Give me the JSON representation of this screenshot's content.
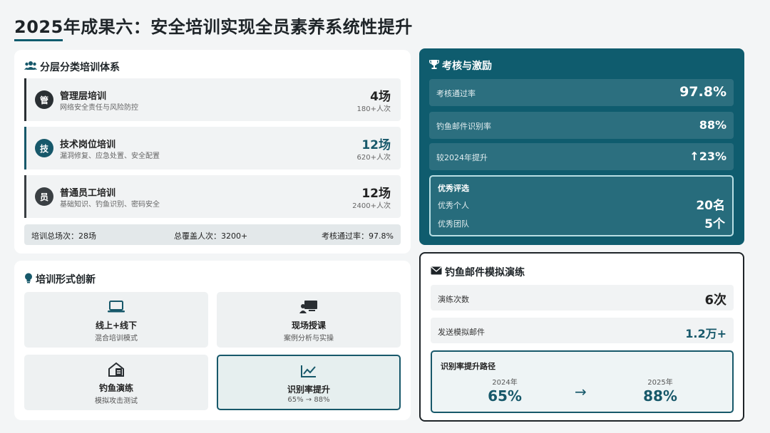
{
  "page": {
    "title": "2025年成果六：安全培训实现全员素养系统性提升"
  },
  "tiers_card": {
    "heading": "分层分类培训体系",
    "tiers": [
      {
        "badge": "管",
        "name": "管理层培训",
        "desc": "网络安全责任与风险防控",
        "value": "4场",
        "sub": "180+人次",
        "badge_color": "#2a2f33",
        "bar_color": "#2a2f33",
        "value_color": "#222222"
      },
      {
        "badge": "技",
        "name": "技术岗位培训",
        "desc": "漏洞修复、应急处置、安全配置",
        "value": "12场",
        "sub": "620+人次",
        "badge_color": "#17586a",
        "bar_color": "#17586a",
        "value_color": "#17586a"
      },
      {
        "badge": "员",
        "name": "普通员工培训",
        "desc": "基础知识、钓鱼识别、密码安全",
        "value": "12场",
        "sub": "2400+人次",
        "badge_color": "#3a3f43",
        "bar_color": "#3a3f43",
        "value_color": "#222222"
      }
    ],
    "summary": {
      "total": "培训总场次：28场",
      "coverage": "总覆盖人次：3200+",
      "pass": "考核通过率：97.8%"
    }
  },
  "forms_card": {
    "heading": "培训形式创新",
    "tiles": [
      {
        "icon": "laptop-icon",
        "label": "线上+线下",
        "sub": "混合培训模式"
      },
      {
        "icon": "presentation-icon",
        "label": "现场授课",
        "sub": "案例分析与实操"
      },
      {
        "icon": "phishing-house-icon",
        "label": "钓鱼演练",
        "sub": "模拟攻击测试"
      },
      {
        "icon": "chart-line-icon",
        "label": "识别率提升",
        "sub": "65% → 88%"
      }
    ]
  },
  "exam_card": {
    "heading": "考核与激励",
    "metrics": [
      {
        "label": "考核通过率",
        "value": "97.8%"
      },
      {
        "label": "钓鱼邮件识别率",
        "value": "88%"
      },
      {
        "label": "较2024年提升",
        "value": "↑23%"
      }
    ],
    "award": {
      "title": "优秀评选",
      "individual_label": "优秀个人",
      "individual_value": "20名",
      "team_label": "优秀团队",
      "team_value": "5个"
    }
  },
  "drill_card": {
    "heading": "钓鱼邮件模拟演练",
    "rows": [
      {
        "label": "演练次数",
        "value": "6次"
      },
      {
        "label": "发送模拟邮件",
        "value": "1.2万+"
      }
    ],
    "path": {
      "title": "识别率提升路径",
      "from_year": "2024年",
      "from_value": "65%",
      "arrow": "→",
      "to_year": "2025年",
      "to_value": "88%"
    }
  },
  "colors": {
    "accent": "#0f5c6e",
    "accent_dark": "#17586a"
  }
}
